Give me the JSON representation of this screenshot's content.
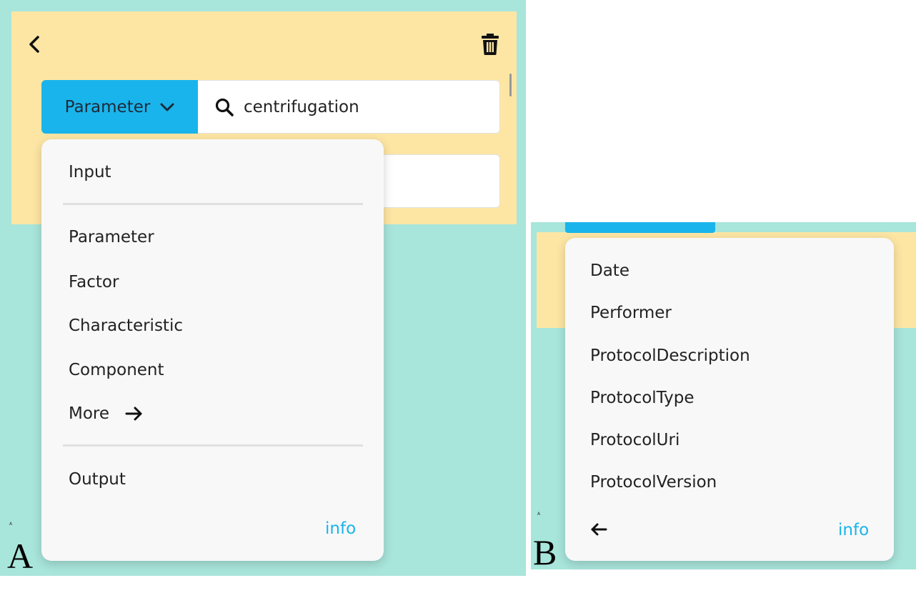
{
  "panel_a": {
    "label": "A",
    "tiny_mark": "A",
    "type_selector": {
      "label": "Parameter"
    },
    "search": {
      "value": "centrifugation"
    },
    "menu": {
      "top_items": [
        {
          "label": "Input"
        }
      ],
      "middle_items": [
        {
          "label": "Parameter"
        },
        {
          "label": "Factor"
        },
        {
          "label": "Characteristic"
        },
        {
          "label": "Component"
        }
      ],
      "more": {
        "label": "More"
      },
      "bottom_items": [
        {
          "label": "Output"
        }
      ],
      "info": "info"
    }
  },
  "panel_b": {
    "label": "B",
    "tiny_mark": "A",
    "menu": {
      "items": [
        {
          "label": "Date"
        },
        {
          "label": "Performer"
        },
        {
          "label": "ProtocolDescription"
        },
        {
          "label": "ProtocolType"
        },
        {
          "label": "ProtocolUri"
        },
        {
          "label": "ProtocolVersion"
        }
      ],
      "info": "info"
    }
  },
  "icons": {
    "back": "chevron-left-icon",
    "trash": "trash-icon",
    "dropdown": "chevron-down-icon",
    "search": "search-icon",
    "more": "arrow-right-icon",
    "return": "arrow-left-icon"
  },
  "colors": {
    "background": "#a8e5db",
    "card": "#fde6a4",
    "accent": "#1ab4ec",
    "menu": "#f8f8f8"
  }
}
